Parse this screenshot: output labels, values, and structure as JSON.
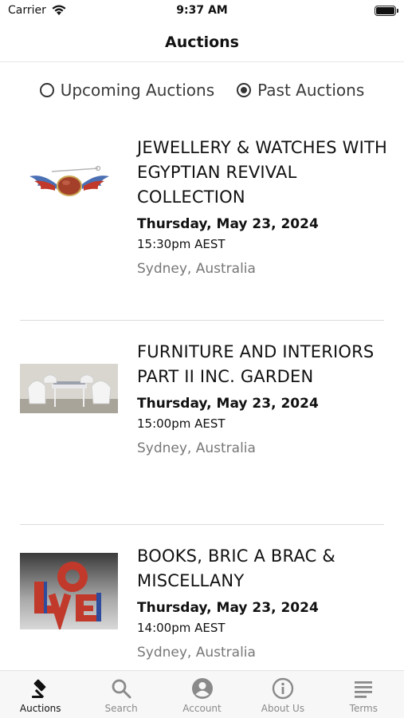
{
  "status": {
    "carrier": "Carrier",
    "time": "9:37 AM"
  },
  "nav": {
    "title": "Auctions"
  },
  "filter": {
    "options": [
      {
        "label": "Upcoming Auctions",
        "selected": false
      },
      {
        "label": "Past Auctions",
        "selected": true
      }
    ]
  },
  "auctions": [
    {
      "title": "JEWELLERY & WATCHES WITH EGYPTIAN REVIVAL COLLECTION",
      "date": "Thursday, May 23, 2024",
      "time": "15:30pm AEST",
      "location": "Sydney, Australia",
      "image": "winged-scarab-brooch"
    },
    {
      "title": "FURNITURE AND INTERIORS PART II INC. GARDEN",
      "date": "Thursday, May 23, 2024",
      "time": "15:00pm AEST",
      "location": "Sydney, Australia",
      "image": "white-garden-furniture-set"
    },
    {
      "title": "BOOKS, BRIC A BRAC & MISCELLANY",
      "date": "Thursday, May 23, 2024",
      "time": "14:00pm AEST",
      "location": "Sydney, Australia",
      "image": "love-sculpture"
    }
  ],
  "tabs": [
    {
      "label": "Auctions",
      "icon": "gavel-icon",
      "active": true
    },
    {
      "label": "Search",
      "icon": "search-icon",
      "active": false
    },
    {
      "label": "Account",
      "icon": "account-icon",
      "active": false
    },
    {
      "label": "About Us",
      "icon": "info-icon",
      "active": false
    },
    {
      "label": "Terms",
      "icon": "terms-icon",
      "active": false
    }
  ],
  "colors": {
    "accent": "#111111",
    "inactive_tab": "#8a8a8a",
    "location_text": "#777777"
  }
}
